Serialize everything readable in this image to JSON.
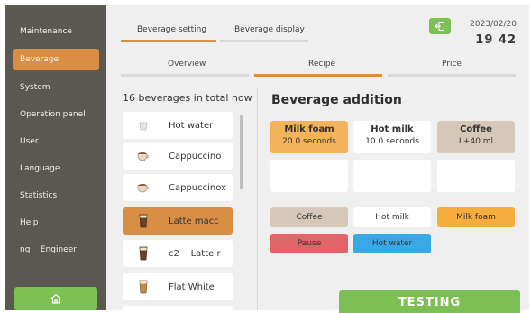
{
  "sidebar": {
    "items": [
      {
        "label": "Maintenance"
      },
      {
        "label": "Beverage"
      },
      {
        "label": "System"
      },
      {
        "label": "Operation panel"
      },
      {
        "label": "User"
      },
      {
        "label": "Language"
      },
      {
        "label": "Statistics"
      },
      {
        "label": "Help"
      },
      {
        "label": "ng    Engineer"
      }
    ],
    "active_index": 1,
    "home_icon": "home-icon"
  },
  "header": {
    "tabs": [
      {
        "label": "Beverage setting"
      },
      {
        "label": "Beverage display"
      }
    ],
    "active_tab": 0,
    "date": "2023/02/20",
    "time": "19 42",
    "logout_icon": "logout-icon"
  },
  "subtabs": [
    {
      "label": "Overview"
    },
    {
      "label": "Recipe"
    },
    {
      "label": "Price"
    }
  ],
  "active_subtab": 1,
  "beverage_list": {
    "total": "16 beverages in total now",
    "items": [
      {
        "name": "Hot water",
        "icon": "cup-icon"
      },
      {
        "name": "Cappuccino",
        "icon": "coffee-cup-icon"
      },
      {
        "name": "Cappuccinox",
        "icon": "coffee-cup-icon"
      },
      {
        "name": "Latte macc",
        "icon": "glass-icon"
      },
      {
        "name": "c2    Latte r",
        "icon": "glass-icon"
      },
      {
        "name": "Flat White",
        "icon": "glass-icon"
      }
    ],
    "selected_index": 3
  },
  "recipe": {
    "title": "Beverage addition",
    "steps": [
      {
        "name": "Milk foam",
        "value": "20.0 seconds"
      },
      {
        "name": "Hot milk",
        "value": "10.0 seconds"
      },
      {
        "name": "Coffee",
        "value": "L+40 ml"
      }
    ],
    "options": [
      {
        "label": "Coffee"
      },
      {
        "label": "Hot milk"
      },
      {
        "label": "Milk foam"
      },
      {
        "label": "Pause"
      },
      {
        "label": "Hot water"
      }
    ],
    "testing_label": "TESTING"
  },
  "colors": {
    "accent_orange": "#d88f45",
    "step_orange": "#f3b35a",
    "coffee_beige": "#d6c8b8",
    "milk_foam_orange": "#f6ad3c",
    "pause_red": "#e06468",
    "hot_water_blue": "#3aa8e4",
    "green": "#7cbf52",
    "sidebar": "#5b5852"
  }
}
